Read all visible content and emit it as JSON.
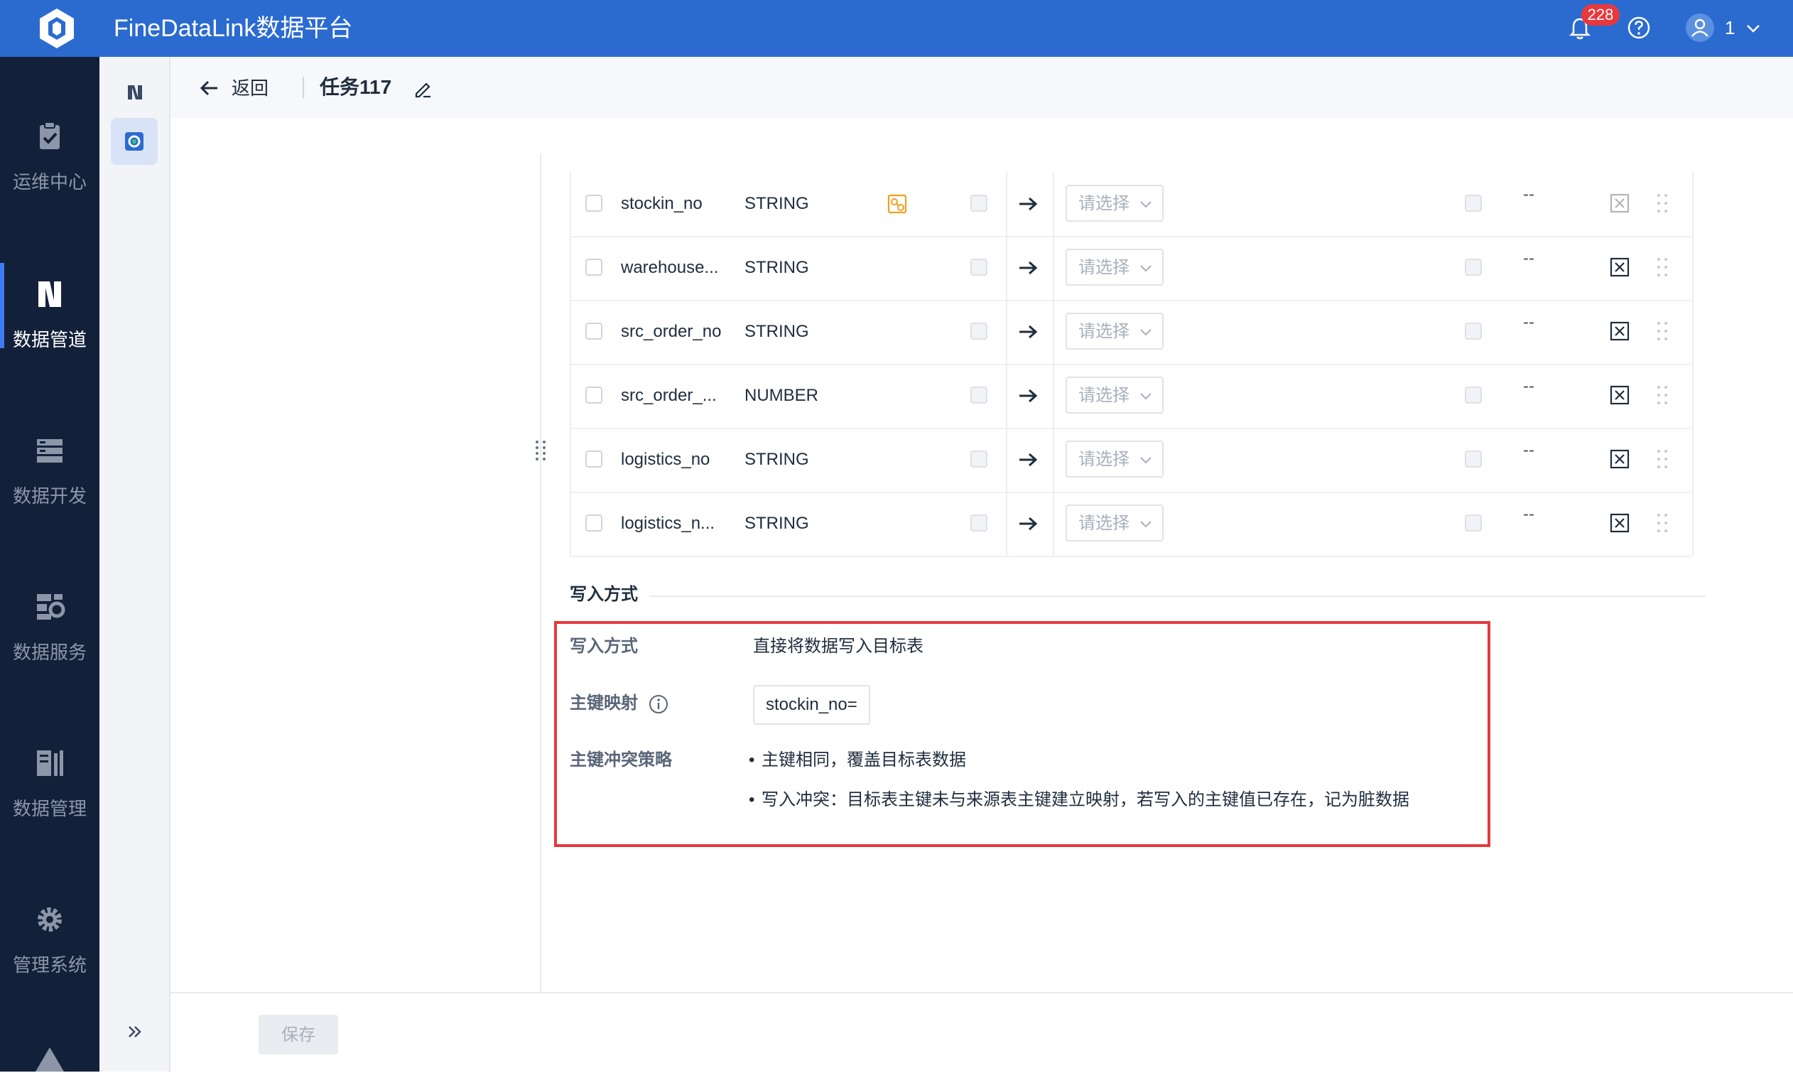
{
  "app": {
    "title": "FineDataLink数据平台"
  },
  "topbar": {
    "notification_count": "228",
    "user_name": "1"
  },
  "leftnav": {
    "items": [
      {
        "label": "运维中心",
        "icon": "ops-center-icon",
        "active": false
      },
      {
        "label": "数据管道",
        "icon": "data-pipeline-icon",
        "active": true
      },
      {
        "label": "数据开发",
        "icon": "data-dev-icon",
        "active": false
      },
      {
        "label": "数据服务",
        "icon": "data-service-icon",
        "active": false
      },
      {
        "label": "数据管理",
        "icon": "data-manage-icon",
        "active": false
      },
      {
        "label": "管理系统",
        "icon": "gear-icon",
        "active": false
      }
    ]
  },
  "header": {
    "back_label": "返回",
    "task_title": "任务117"
  },
  "mapping": {
    "select_placeholder": "请选择",
    "empty_value": "--",
    "rows": [
      {
        "name": "stockin_no",
        "type": "STRING",
        "is_primary_key": true
      },
      {
        "name": "warehouse...",
        "type": "STRING",
        "is_primary_key": false
      },
      {
        "name": "src_order_no",
        "type": "STRING",
        "is_primary_key": false
      },
      {
        "name": "src_order_...",
        "type": "NUMBER",
        "is_primary_key": false
      },
      {
        "name": "logistics_no",
        "type": "STRING",
        "is_primary_key": false
      },
      {
        "name": "logistics_n...",
        "type": "STRING",
        "is_primary_key": false
      }
    ]
  },
  "write_section": {
    "title": "写入方式",
    "write_mode_label": "写入方式",
    "write_mode_value": "直接将数据写入目标表",
    "pk_mapping_label": "主键映射",
    "pk_mapping_value": "stockin_no=",
    "conflict_label": "主键冲突策略",
    "conflict_items": [
      "主键相同，覆盖目标表数据",
      "写入冲突：目标表主键未与来源表主键建立映射，若写入的主键值已存在，记为脏数据"
    ]
  },
  "footer": {
    "save_label": "保存"
  },
  "colors": {
    "topbar": "#2b6bd0",
    "leftnav": "#13203a",
    "highlight": "#e4393c",
    "badge": "#e8383d",
    "pk_icon": "#f0a020"
  }
}
